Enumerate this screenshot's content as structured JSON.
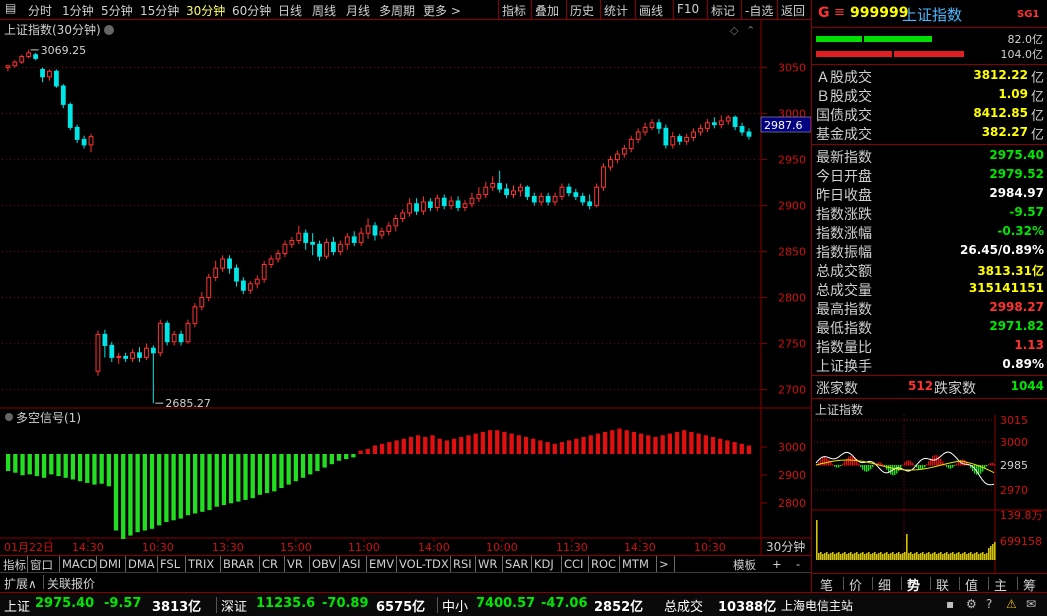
{
  "toolbar": {
    "periods": [
      "分时",
      "1分钟",
      "5分钟",
      "15分钟",
      "30分钟",
      "60分钟",
      "日线",
      "周线",
      "月线",
      "多周期",
      "更多 >"
    ],
    "active_period": "30分钟",
    "tools": [
      "指标",
      "叠加",
      "历史",
      "统计",
      "画线",
      "F10",
      "标记",
      "-自选",
      "返回"
    ]
  },
  "main_chart": {
    "title": "上证指数(30分钟)",
    "high_label": "3069.25",
    "low_label": "2685.27",
    "current_price_tag": "2987.6",
    "y_ticks": [
      "3050",
      "3000",
      "2950",
      "2900",
      "2850",
      "2800",
      "2750",
      "2700"
    ],
    "indicator_title": "多空信号(1)",
    "indicator_ticks": [
      "3000",
      "2900",
      "2800"
    ]
  },
  "chart_data": {
    "type": "candlestick",
    "title": "上证指数(30分钟)",
    "y_range": [
      2680,
      3080
    ],
    "candles": [
      [
        3050,
        3052,
        3046,
        3053
      ],
      [
        3052,
        3056,
        3050,
        3058
      ],
      [
        3056,
        3062,
        3054,
        3064
      ],
      [
        3062,
        3066,
        3060,
        3069.25
      ],
      [
        3064,
        3060,
        3058,
        3066
      ],
      [
        3048,
        3040,
        3034,
        3050
      ],
      [
        3040,
        3046,
        3036,
        3048
      ],
      [
        3046,
        3030,
        3028,
        3048
      ],
      [
        3030,
        3010,
        3006,
        3032
      ],
      [
        3010,
        2985,
        2982,
        3012
      ],
      [
        2985,
        2972,
        2968,
        2988
      ],
      [
        2972,
        2966,
        2962,
        2976
      ],
      [
        2966,
        2975,
        2958,
        2978
      ],
      [
        2720,
        2760,
        2715,
        2764
      ],
      [
        2760,
        2748,
        2735,
        2765
      ],
      [
        2748,
        2735,
        2730,
        2752
      ],
      [
        2735,
        2736,
        2728,
        2740
      ],
      [
        2736,
        2734,
        2730,
        2740
      ],
      [
        2734,
        2740,
        2730,
        2744
      ],
      [
        2740,
        2735,
        2730,
        2746
      ],
      [
        2735,
        2745,
        2732,
        2750
      ],
      [
        2745,
        2740,
        2685.27,
        2748
      ],
      [
        2740,
        2772,
        2736,
        2776
      ],
      [
        2772,
        2752,
        2748,
        2775
      ],
      [
        2752,
        2760,
        2748,
        2764
      ],
      [
        2760,
        2752,
        2748,
        2764
      ],
      [
        2752,
        2772,
        2750,
        2776
      ],
      [
        2772,
        2790,
        2768,
        2794
      ],
      [
        2790,
        2800,
        2786,
        2806
      ],
      [
        2800,
        2822,
        2796,
        2826
      ],
      [
        2822,
        2832,
        2818,
        2840
      ],
      [
        2832,
        2842,
        2828,
        2846
      ],
      [
        2842,
        2832,
        2826,
        2846
      ],
      [
        2832,
        2818,
        2812,
        2836
      ],
      [
        2818,
        2808,
        2804,
        2822
      ],
      [
        2808,
        2815,
        2804,
        2818
      ],
      [
        2815,
        2820,
        2810,
        2824
      ],
      [
        2820,
        2836,
        2816,
        2840
      ],
      [
        2836,
        2842,
        2832,
        2846
      ],
      [
        2842,
        2848,
        2838,
        2852
      ],
      [
        2848,
        2858,
        2844,
        2862
      ],
      [
        2858,
        2862,
        2854,
        2866
      ],
      [
        2862,
        2870,
        2858,
        2878
      ],
      [
        2870,
        2860,
        2852,
        2874
      ],
      [
        2860,
        2858,
        2846,
        2870
      ],
      [
        2858,
        2845,
        2840,
        2862
      ],
      [
        2845,
        2860,
        2842,
        2864
      ],
      [
        2860,
        2850,
        2846,
        2866
      ],
      [
        2850,
        2858,
        2846,
        2862
      ],
      [
        2858,
        2866,
        2852,
        2870
      ],
      [
        2866,
        2860,
        2856,
        2872
      ],
      [
        2860,
        2870,
        2856,
        2876
      ],
      [
        2870,
        2878,
        2864,
        2886
      ],
      [
        2878,
        2868,
        2862,
        2882
      ],
      [
        2868,
        2872,
        2864,
        2876
      ],
      [
        2872,
        2878,
        2868,
        2882
      ],
      [
        2878,
        2886,
        2872,
        2890
      ],
      [
        2886,
        2892,
        2882,
        2896
      ],
      [
        2892,
        2902,
        2888,
        2908
      ],
      [
        2902,
        2894,
        2890,
        2908
      ],
      [
        2894,
        2904,
        2890,
        2910
      ],
      [
        2904,
        2898,
        2894,
        2908
      ],
      [
        2898,
        2908,
        2894,
        2912
      ],
      [
        2908,
        2900,
        2896,
        2912
      ],
      [
        2900,
        2905,
        2896,
        2910
      ],
      [
        2905,
        2898,
        2894,
        2910
      ],
      [
        2898,
        2902,
        2894,
        2906
      ],
      [
        2902,
        2908,
        2898,
        2914
      ],
      [
        2908,
        2912,
        2904,
        2920
      ],
      [
        2912,
        2920,
        2908,
        2926
      ],
      [
        2920,
        2924,
        2916,
        2932
      ],
      [
        2924,
        2918,
        2914,
        2938
      ],
      [
        2918,
        2912,
        2908,
        2924
      ],
      [
        2912,
        2916,
        2908,
        2922
      ],
      [
        2916,
        2920,
        2910,
        2924
      ],
      [
        2920,
        2910,
        2906,
        2922
      ],
      [
        2910,
        2904,
        2900,
        2914
      ],
      [
        2904,
        2910,
        2900,
        2914
      ],
      [
        2910,
        2904,
        2900,
        2914
      ],
      [
        2904,
        2910,
        2900,
        2914
      ],
      [
        2910,
        2920,
        2906,
        2924
      ],
      [
        2920,
        2914,
        2910,
        2924
      ],
      [
        2914,
        2910,
        2906,
        2918
      ],
      [
        2910,
        2904,
        2900,
        2914
      ],
      [
        2904,
        2900,
        2896,
        2912
      ],
      [
        2900,
        2920,
        2898,
        2924
      ],
      [
        2920,
        2942,
        2916,
        2946
      ],
      [
        2942,
        2950,
        2938,
        2954
      ],
      [
        2950,
        2956,
        2946,
        2960
      ],
      [
        2956,
        2962,
        2952,
        2966
      ],
      [
        2962,
        2972,
        2958,
        2976
      ],
      [
        2972,
        2980,
        2968,
        2984
      ],
      [
        2980,
        2985,
        2976,
        2990
      ],
      [
        2985,
        2990,
        2982,
        2994
      ],
      [
        2990,
        2984,
        2978,
        2994
      ],
      [
        2984,
        2966,
        2962,
        2988
      ],
      [
        2966,
        2975,
        2962,
        2980
      ],
      [
        2975,
        2970,
        2966,
        2978
      ],
      [
        2970,
        2974,
        2966,
        2978
      ],
      [
        2974,
        2980,
        2970,
        2984
      ],
      [
        2980,
        2984,
        2976,
        2988
      ],
      [
        2984,
        2990,
        2980,
        2994
      ],
      [
        2990,
        2988,
        2984,
        2996
      ],
      [
        2988,
        2992,
        2984,
        2998
      ],
      [
        2992,
        2996,
        2988,
        2998.27
      ],
      [
        2996,
        2986,
        2982,
        2998
      ],
      [
        2986,
        2980,
        2976,
        2990
      ],
      [
        2980,
        2975.4,
        2971.82,
        2984
      ]
    ],
    "indicator_values": [
      -20,
      -22,
      -25,
      -24,
      -26,
      -28,
      -24,
      -26,
      -28,
      -30,
      -32,
      -34,
      -36,
      -35,
      -38,
      -90,
      -100,
      -96,
      -92,
      -90,
      -88,
      -84,
      -80,
      -78,
      -76,
      -72,
      -70,
      -68,
      -66,
      -62,
      -60,
      -58,
      -56,
      -54,
      -52,
      -48,
      -46,
      -44,
      -40,
      -36,
      -32,
      -28,
      -24,
      -20,
      -16,
      -12,
      -8,
      -6,
      -4,
      4,
      6,
      10,
      12,
      14,
      16,
      18,
      20,
      22,
      20,
      22,
      18,
      16,
      18,
      20,
      22,
      24,
      26,
      28,
      28,
      26,
      24,
      22,
      20,
      18,
      16,
      14,
      12,
      14,
      16,
      18,
      20,
      22,
      24,
      26,
      28,
      30,
      28,
      26,
      24,
      22,
      20,
      22,
      24,
      26,
      28,
      26,
      24,
      22,
      20,
      18,
      16,
      14,
      12,
      10
    ]
  },
  "x_axis_labels": [
    "01月22日",
    "14:30",
    "10:30",
    "13:30",
    "15:00",
    "11:00",
    "14:00",
    "10:00",
    "11:30",
    "14:30",
    "10:30"
  ],
  "x_axis_period": "30分钟",
  "indicator_tabs": [
    "指标",
    "窗口",
    "MACD",
    "DMI",
    "DMA",
    "FSL",
    "TRIX",
    "BRAR",
    "CR",
    "VR",
    "OBV",
    "ASI",
    "EMV",
    "VOL-TDX",
    "RSI",
    "WR",
    "SAR",
    "KDJ",
    "CCI",
    "ROC",
    "MTM",
    ">",
    "模板",
    "+",
    "-"
  ],
  "ext_bar": {
    "expand": "扩展∧",
    "linked": "关联报价"
  },
  "right_panel": {
    "header_letter": "G",
    "header_code": "999999",
    "header_name": "上证指数",
    "header_tag": "SG1",
    "bar1_value": "82.0亿",
    "bar2_value": "104.0亿",
    "turnover": [
      {
        "label": "Ａ股成交",
        "value": "3812.22",
        "unit": "亿"
      },
      {
        "label": "Ｂ股成交",
        "value": "1.09",
        "unit": "亿"
      },
      {
        "label": "国债成交",
        "value": "8412.85",
        "unit": "亿"
      },
      {
        "label": "基金成交",
        "value": "382.27",
        "unit": "亿"
      }
    ],
    "stats": [
      {
        "label": "最新指数",
        "value": "2975.40",
        "color": "green"
      },
      {
        "label": "今日开盘",
        "value": "2979.52",
        "color": "green"
      },
      {
        "label": "昨日收盘",
        "value": "2984.97",
        "color": "white"
      },
      {
        "label": "指数涨跌",
        "value": "-9.57",
        "color": "green"
      },
      {
        "label": "指数涨幅",
        "value": "-0.32%",
        "color": "green"
      },
      {
        "label": "指数振幅",
        "value": "26.45/0.89%",
        "color": "white"
      },
      {
        "label": "总成交额",
        "value": "3813.31亿",
        "color": "yellow"
      },
      {
        "label": "总成交量",
        "value": "315141151",
        "color": "yellow"
      },
      {
        "label": "最高指数",
        "value": "2998.27",
        "color": "red"
      },
      {
        "label": "最低指数",
        "value": "2971.82",
        "color": "green"
      },
      {
        "label": "指数量比",
        "value": "1.13",
        "color": "red"
      },
      {
        "label": "上证换手",
        "value": "0.89%",
        "color": "white"
      }
    ],
    "rise_label": "涨家数",
    "rise_value": "512",
    "fall_label": "跌家数",
    "fall_value": "1044",
    "mini_title": "上证指数",
    "mini_ticks": [
      "3015",
      "3000",
      "2985",
      "2970"
    ],
    "mini_volume_ticks": [
      "139.8万",
      "699158"
    ],
    "bottom_tabs": [
      "笔",
      "价",
      "细",
      "势",
      "联",
      "值",
      "主",
      "筹"
    ],
    "active_bottom_tab": "势"
  },
  "status_bar": {
    "items": [
      {
        "name": "上证",
        "price": "2975.40",
        "change": "-9.57",
        "volume": "3813亿"
      },
      {
        "name": "深证",
        "price": "11235.6",
        "change": "-70.89",
        "volume": "6575亿"
      },
      {
        "name": "中小",
        "price": "7400.57",
        "change": "-47.06",
        "volume": "2852亿"
      }
    ],
    "total_label": "总成交",
    "total_value": "10388亿",
    "server": "上海电信主站"
  },
  "colors": {
    "up": "#ff3232",
    "down": "#00e5e5",
    "ind_up": "#e01010",
    "ind_down": "#22dd22",
    "grid": "#8a0000",
    "axis_text": "#d01010"
  }
}
